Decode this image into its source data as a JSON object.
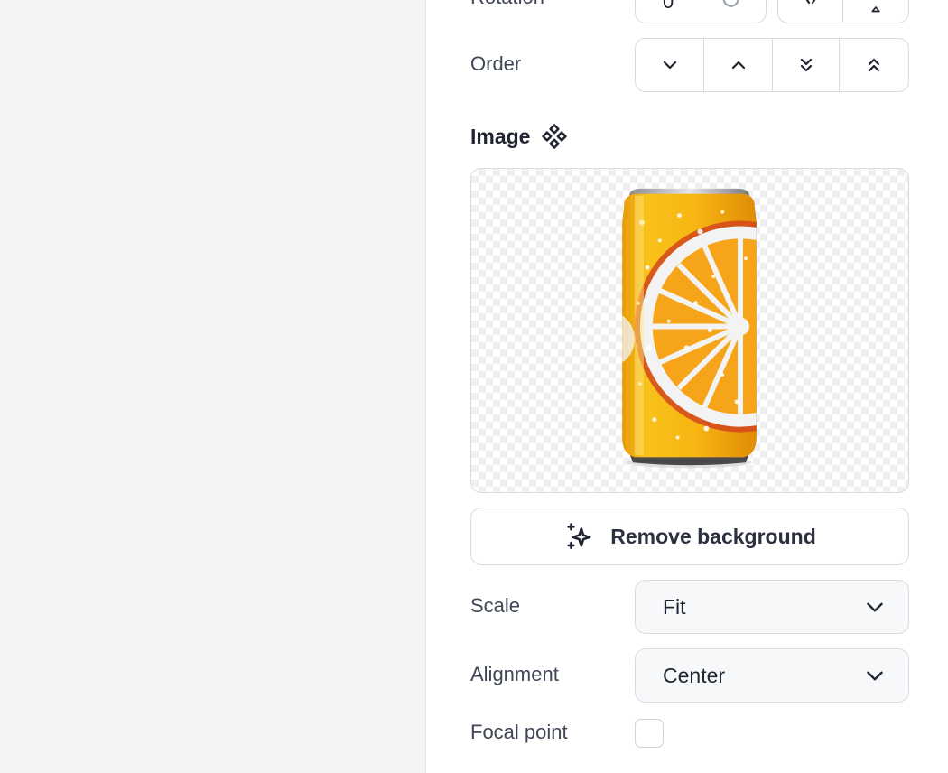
{
  "layout_panel": {
    "rotation": {
      "label": "Rotation",
      "value": "0"
    },
    "order": {
      "label": "Order",
      "buttons": [
        {
          "name": "send-backward",
          "icon": "chevron-down-icon"
        },
        {
          "name": "bring-forward",
          "icon": "chevron-up-icon"
        },
        {
          "name": "send-to-back",
          "icon": "double-chevron-down-icon"
        },
        {
          "name": "bring-to-front",
          "icon": "double-chevron-up-icon"
        }
      ]
    }
  },
  "image_section": {
    "title": "Image",
    "title_icon": "component-diamond-icon",
    "preview_icon": "orange-soda-can-image",
    "remove_bg_label": "Remove background",
    "remove_bg_icon": "sparkles-icon"
  },
  "scale": {
    "label": "Scale",
    "value": "Fit"
  },
  "alignment": {
    "label": "Alignment",
    "value": "Center"
  },
  "focal_point": {
    "label": "Focal point",
    "checked": false
  },
  "colors": {
    "text_primary": "#1f2430",
    "text_label": "#3f4655",
    "border": "#d9dbe0",
    "canvas_bg": "#f4f4f5",
    "can_yellow": "#f6b512",
    "can_orange": "#f39a10"
  }
}
